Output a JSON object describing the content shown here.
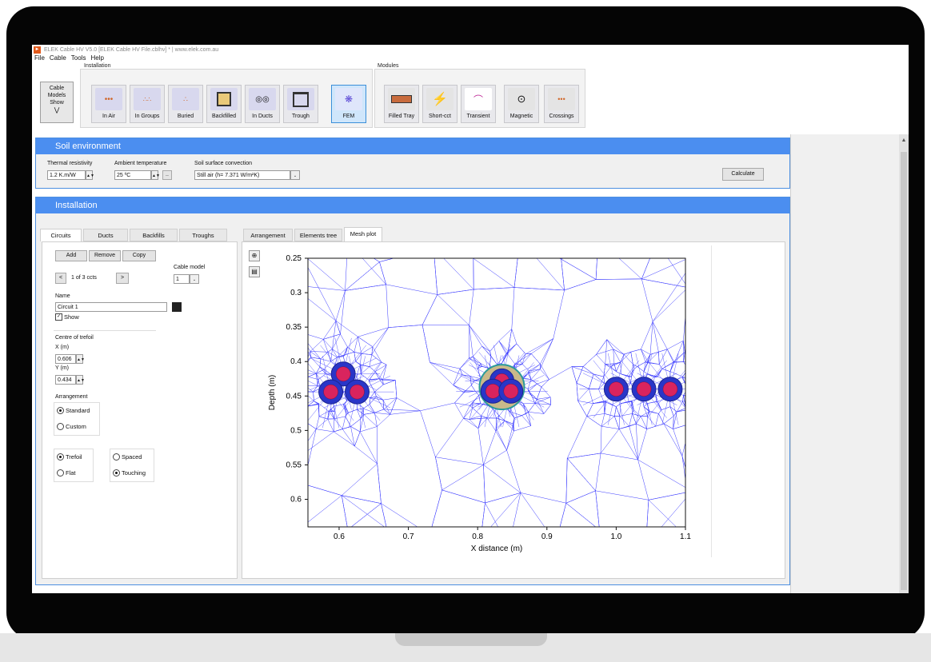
{
  "window": {
    "title": "ELEK Cable HV V5.0  [ELEK Cable HV File.cblhv] * | www.elek.com.au"
  },
  "menu": [
    "File",
    "Cable",
    "Tools",
    "Help"
  ],
  "ribbon": {
    "installation_label": "Installation",
    "modules_label": "Modules",
    "models_button": [
      "Cable",
      "Models",
      "Show"
    ],
    "installation_buttons": [
      "In Air",
      "In Groups",
      "Buried",
      "Backfilled",
      "In Ducts",
      "Trough",
      "FEM"
    ],
    "module_buttons": [
      "Filled Tray",
      "Short-cct",
      "Transient",
      "Magnetic",
      "Crossings"
    ],
    "active": "FEM"
  },
  "soil": {
    "header": "Soil environment",
    "thermal_label": "Thermal resistivity",
    "thermal_value": "1.2 K.m/W",
    "ambient_label": "Ambient temperature",
    "ambient_value": "25 ºC",
    "ambient_more": "..",
    "convection_label": "Soil surface convection",
    "convection_value": "Still air (h= 7.371 W/m²K)",
    "calculate": "Calculate"
  },
  "installation": {
    "header": "Installation",
    "left_tabs": [
      "Circuits",
      "Ducts",
      "Backfills",
      "Troughs"
    ],
    "right_tabs": [
      "Arrangement",
      "Elements tree",
      "Mesh plot"
    ],
    "add": "Add",
    "remove": "Remove",
    "copy": "Copy",
    "nav_prev": "<",
    "nav_next": ">",
    "circuit_counter": "1 of 3 ccts",
    "cable_model_label": "Cable model",
    "cable_model_value": "1",
    "name_label": "Name",
    "name_value": "Circuit 1",
    "show_label": "Show",
    "centre_label": "Centre of trefoil",
    "x_label": "X (m)",
    "x_value": "0.606",
    "y_label": "Y (m)",
    "y_value": "0.434",
    "arrangement_label": "Arrangement",
    "standard": "Standard",
    "custom": "Custom",
    "trefoil": "Trefoil",
    "flat": "Flat",
    "spaced": "Spaced",
    "touching": "Touching"
  },
  "chart_data": {
    "type": "scatter",
    "title": "",
    "xlabel": "X distance (m)",
    "ylabel": "Depth (m)",
    "xlim": [
      0.555,
      1.1
    ],
    "ylim": [
      0.25,
      0.64
    ],
    "y_inverted": true,
    "xticks": [
      "0.6",
      "0.7",
      "0.8",
      "0.9",
      "1.0",
      "1.1"
    ],
    "xtick_values": [
      0.6,
      0.7,
      0.8,
      0.9,
      1.0,
      1.1
    ],
    "yticks": [
      "0.25",
      "0.3",
      "0.35",
      "0.4",
      "0.45",
      "0.5",
      "0.55",
      "0.6"
    ],
    "ytick_values": [
      0.25,
      0.3,
      0.35,
      0.4,
      0.45,
      0.5,
      0.55,
      0.6
    ],
    "cables": [
      {
        "x": 0.606,
        "y": 0.418
      },
      {
        "x": 0.588,
        "y": 0.444
      },
      {
        "x": 0.626,
        "y": 0.444
      },
      {
        "x": 0.835,
        "y": 0.428
      },
      {
        "x": 0.822,
        "y": 0.443
      },
      {
        "x": 0.848,
        "y": 0.443
      },
      {
        "x": 1.0,
        "y": 0.44
      },
      {
        "x": 1.04,
        "y": 0.44
      },
      {
        "x": 1.078,
        "y": 0.44
      }
    ],
    "duct": {
      "x": 0.835,
      "y": 0.437
    },
    "colors": {
      "mesh": "#3b3bff",
      "cable": "#2936c8",
      "core": "#d9245e",
      "duct": "#2a9a9a"
    }
  }
}
